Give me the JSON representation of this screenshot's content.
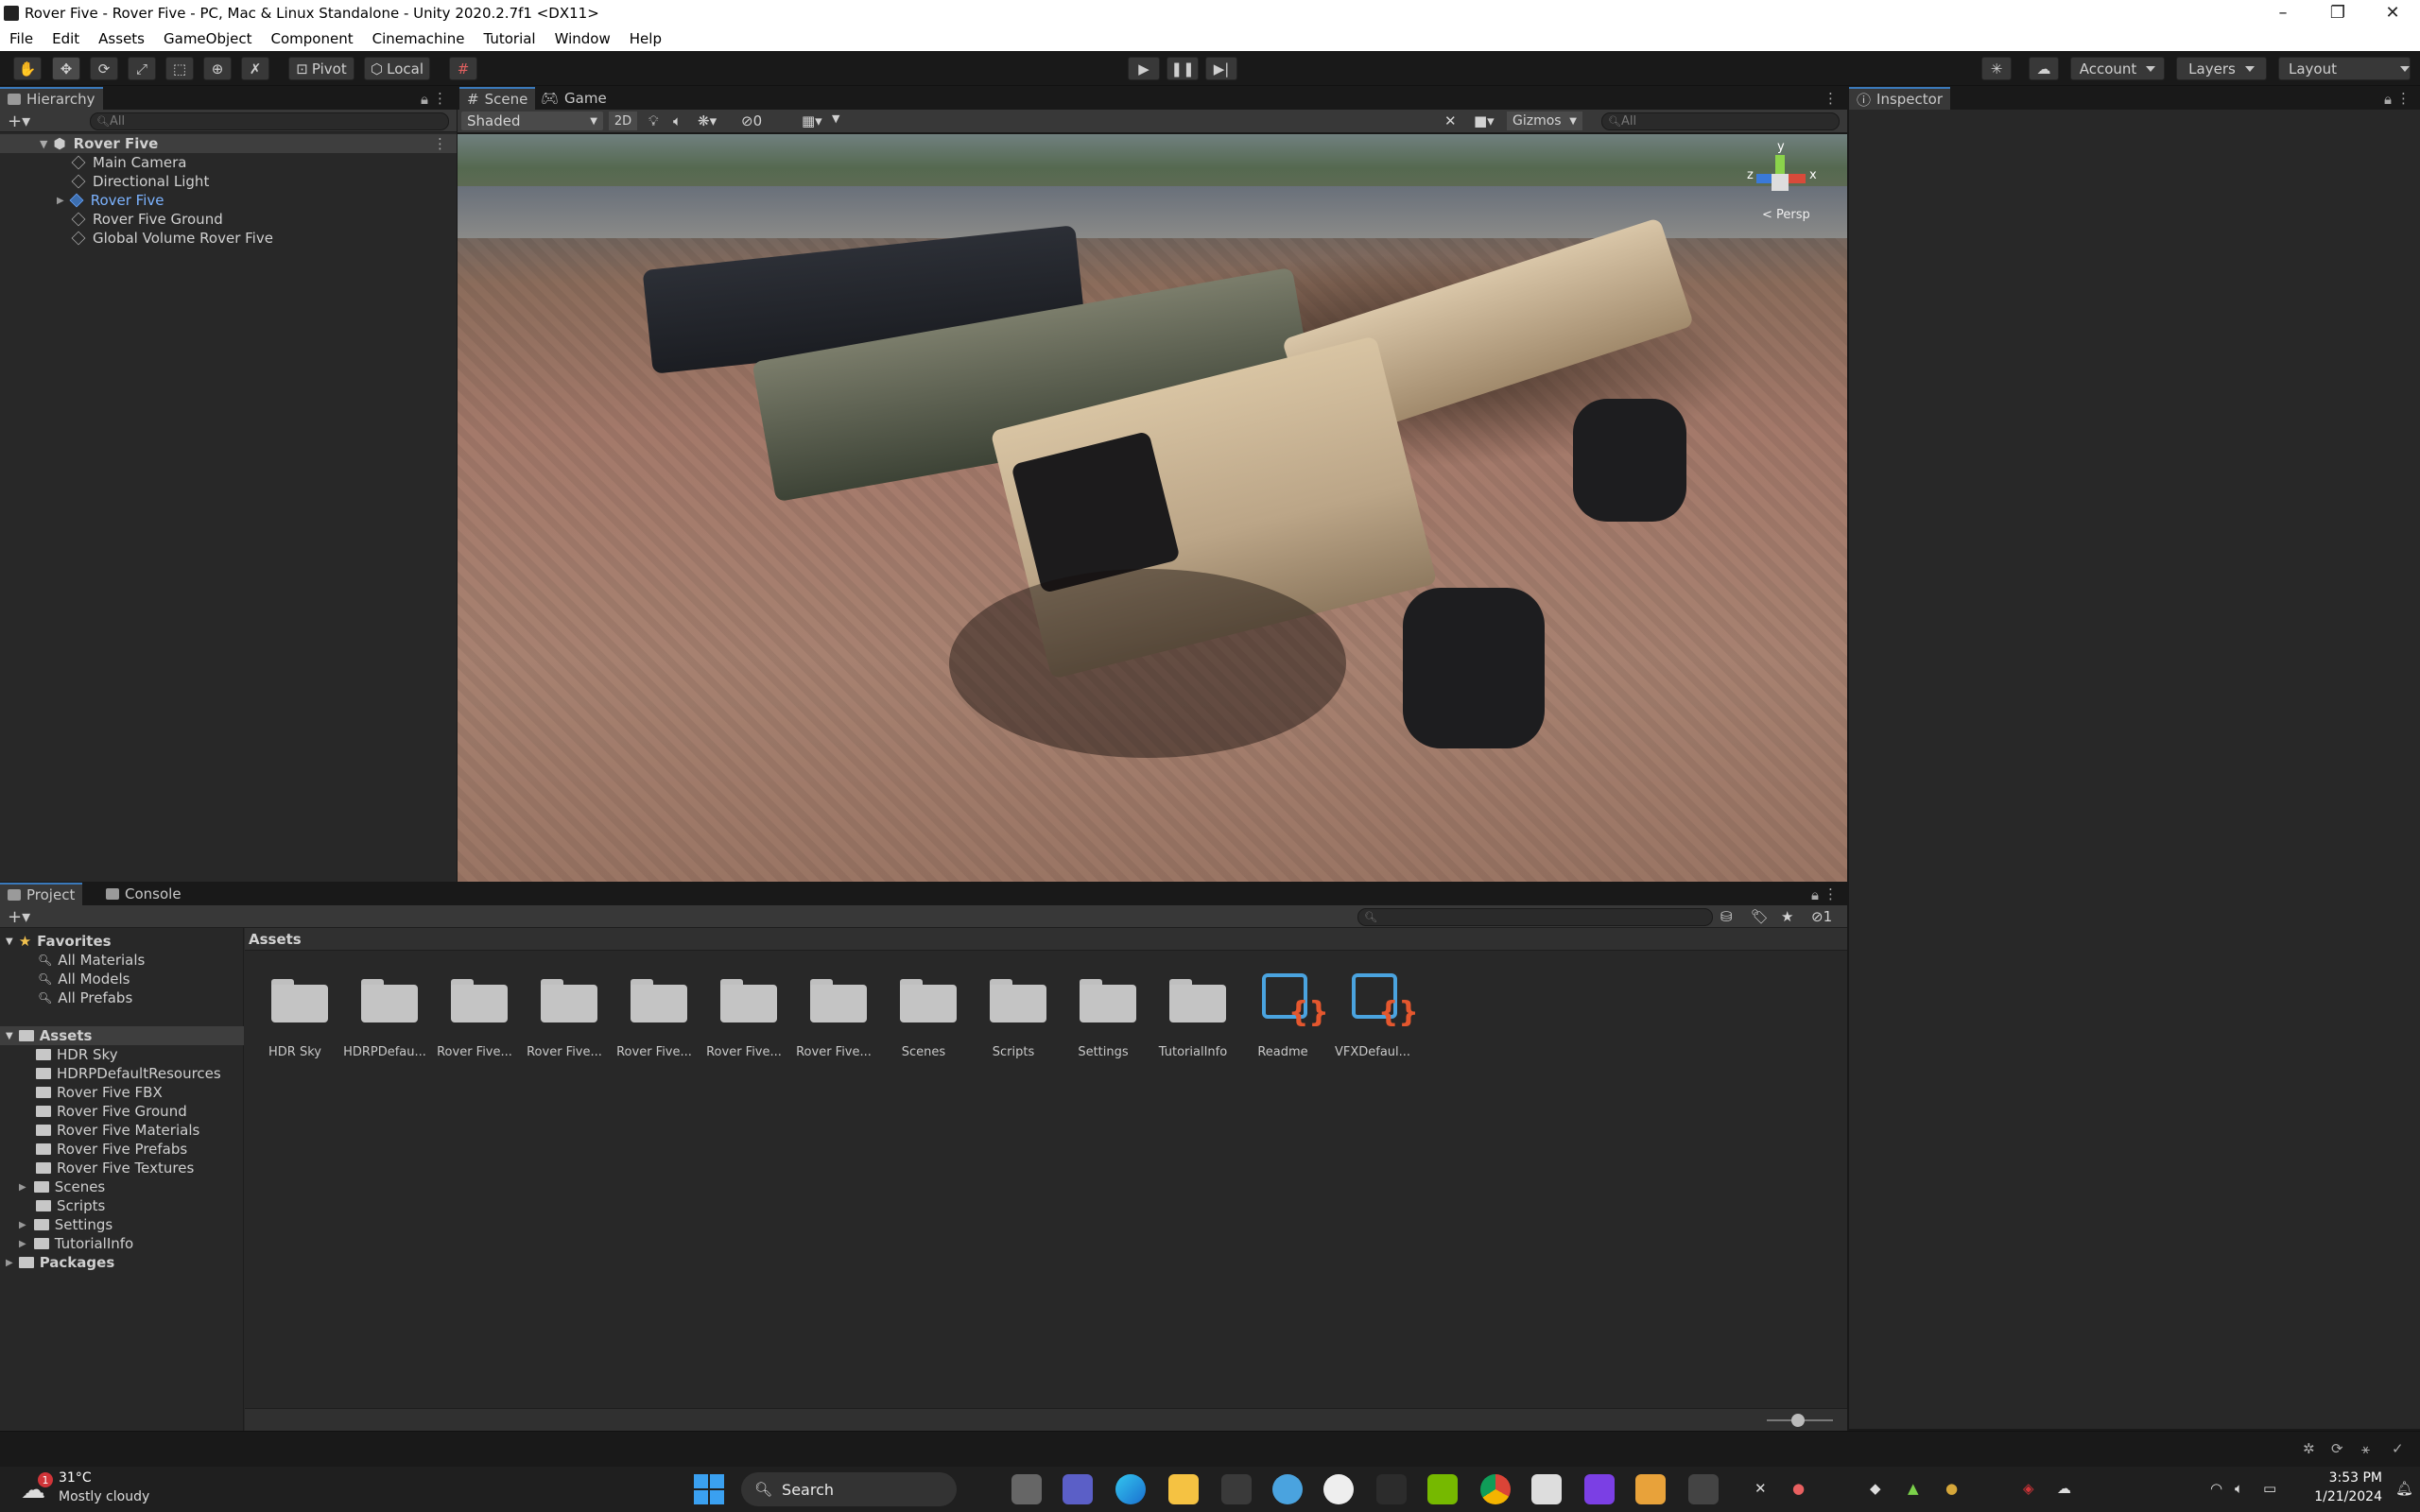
{
  "window": {
    "title": "Rover Five - Rover Five - PC, Mac & Linux Standalone - Unity 2020.2.7f1 <DX11>",
    "minimize": "–",
    "restore": "❐",
    "close": "✕"
  },
  "menu": [
    "File",
    "Edit",
    "Assets",
    "GameObject",
    "Component",
    "Cinemachine",
    "Tutorial",
    "Window",
    "Help"
  ],
  "toolbar": {
    "pivot_label": "Pivot",
    "local_label": "Local",
    "account_label": "Account",
    "layers_label": "Layers",
    "layout_label": "Layout"
  },
  "hierarchy": {
    "tab_label": "Hierarchy",
    "search_placeholder": "All",
    "scene_name": "Rover Five",
    "items": [
      "Main Camera",
      "Directional Light",
      "Rover Five",
      "Rover Five Ground",
      "Global Volume Rover Five"
    ]
  },
  "scene": {
    "tab_scene": "Scene",
    "tab_game": "Game",
    "shading_mode": "Shaded",
    "mode_2d": "2D",
    "hidden_count": "0",
    "gizmos_label": "Gizmos",
    "search_placeholder": "All",
    "persp_label": "< Persp",
    "axis_y": "y",
    "axis_z": "z",
    "axis_x": "x"
  },
  "inspector": {
    "tab_label": "Inspector"
  },
  "project": {
    "tab_project": "Project",
    "tab_console": "Console",
    "breadcrumb": "Assets",
    "hidden_packages_count": "1",
    "favorites_label": "Favorites",
    "favorites": [
      "All Materials",
      "All Models",
      "All Prefabs"
    ],
    "assets_label": "Assets",
    "assets_tree": [
      "HDR Sky",
      "HDRPDefaultResources",
      "Rover Five FBX",
      "Rover Five Ground",
      "Rover Five Materials",
      "Rover Five Prefabs",
      "Rover Five Textures",
      "Scenes",
      "Scripts",
      "Settings",
      "TutorialInfo"
    ],
    "packages_label": "Packages",
    "grid_items": [
      "HDR Sky",
      "HDRPDefau...",
      "Rover Five...",
      "Rover Five...",
      "Rover Five...",
      "Rover Five...",
      "Rover Five...",
      "Scenes",
      "Scripts",
      "Settings",
      "TutorialInfo",
      "Readme",
      "VFXDefaul..."
    ]
  },
  "taskbar": {
    "weather_temp": "31°C",
    "weather_desc": "Mostly cloudy",
    "weather_badge": "1",
    "search_label": "Search",
    "time": "3:53 PM",
    "date": "1/21/2024"
  },
  "colors": {
    "accent": "#3a79bb",
    "selected_text": "#7cb3ff",
    "panel_bg": "#282828",
    "script_orange": "#e4572e",
    "script_blue": "#4aa3df"
  }
}
